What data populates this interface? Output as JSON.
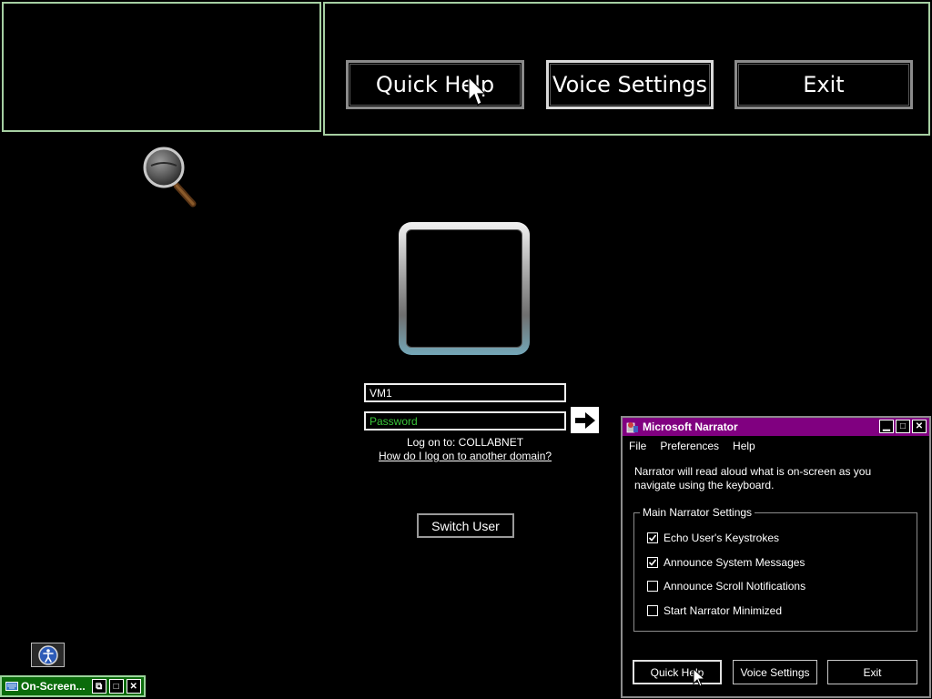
{
  "narrator_bar": {
    "quick_help_label": "Quick Help",
    "voice_settings_label": "Voice Settings",
    "exit_label": "Exit"
  },
  "logon": {
    "username_value": "VM1",
    "password_placeholder": "Password",
    "logon_to_text": "Log on to: COLLABNET",
    "domain_link_text": "How do I log on to another domain?",
    "switch_user_label": "Switch User"
  },
  "taskbar": {
    "osk_label": "On-Screen..."
  },
  "narrator_window": {
    "title": "Microsoft Narrator",
    "menu": [
      "File",
      "Preferences",
      "Help"
    ],
    "description": "Narrator will read aloud what is on-screen as you navigate using the keyboard.",
    "group_label": "Main Narrator Settings",
    "options": [
      {
        "label": "Echo User's Keystrokes",
        "checked": true
      },
      {
        "label": "Announce System Messages",
        "checked": true
      },
      {
        "label": "Announce Scroll Notifications",
        "checked": false
      },
      {
        "label": "Start Narrator Minimized",
        "checked": false
      }
    ],
    "buttons": {
      "quick_help": "Quick Help",
      "voice_settings": "Voice Settings",
      "exit": "Exit"
    }
  },
  "colors": {
    "background": "#000000",
    "border_green": "#a6cfa2",
    "title_purple": "#800080",
    "password_green": "#39c439",
    "osk_green": "#0b6b0b"
  }
}
